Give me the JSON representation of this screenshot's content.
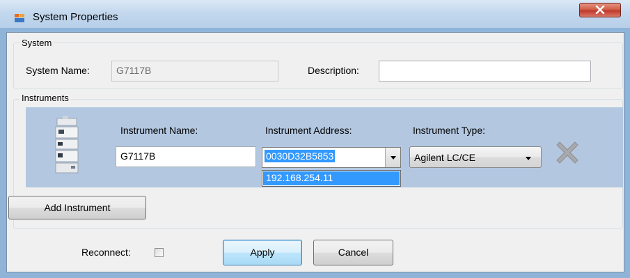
{
  "window": {
    "title": "System Properties",
    "icon": "app-window-icon",
    "close_icon": "close-icon"
  },
  "system_group": {
    "legend": "System",
    "system_name_label": "System Name:",
    "system_name_value": "G7117B",
    "description_label": "Description:",
    "description_value": ""
  },
  "instruments_group": {
    "legend": "Instruments",
    "instrument": {
      "image_icon": "lc-instrument-icon",
      "name_label": "Instrument Name:",
      "name_value": "G7117B",
      "address_label": "Instrument Address:",
      "address_value": "0030D32B5853",
      "address_options": [
        "192.168.254.11"
      ],
      "type_label": "Instrument Type:",
      "type_value": "Agilent LC/CE",
      "remove_icon": "remove-x-icon"
    },
    "add_instrument_label": "Add Instrument"
  },
  "footer": {
    "reconnect_label": "Reconnect:",
    "reconnect_checked": false,
    "apply_label": "Apply",
    "cancel_label": "Cancel"
  },
  "colors": {
    "panel_highlight": "#b3c7e0",
    "selection": "#3399ff",
    "close_button": "#c0392b"
  }
}
